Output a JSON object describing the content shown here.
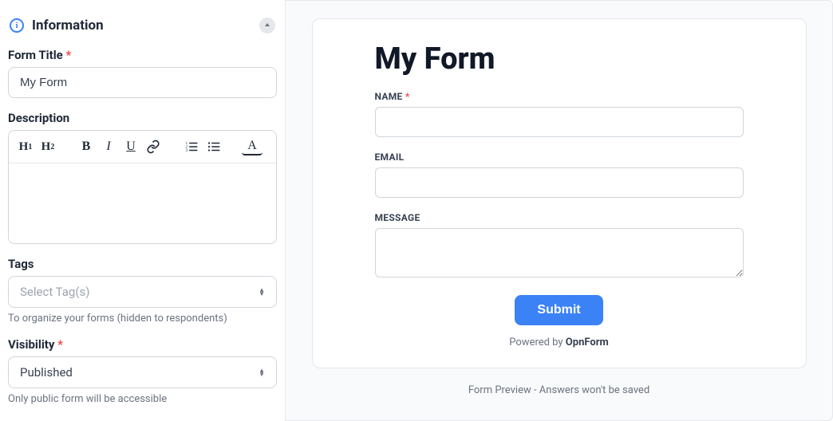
{
  "sidebar": {
    "section_title": "Information",
    "form_title_label": "Form Title",
    "form_title_value": "My Form",
    "description_label": "Description",
    "tags_label": "Tags",
    "tags_placeholder": "Select Tag(s)",
    "tags_hint": "To organize your forms (hidden to respondents)",
    "visibility_label": "Visibility",
    "visibility_value": "Published",
    "visibility_hint": "Only public form will be accessible",
    "required_mark": "*"
  },
  "rte_buttons": {
    "h1": "H",
    "h1_sub": "1",
    "h2": "H",
    "h2_sub": "2",
    "bold": "B",
    "italic": "I",
    "underline": "U",
    "color": "A"
  },
  "preview": {
    "title": "My Form",
    "fields": [
      {
        "label": "NAME",
        "required": true,
        "type": "text"
      },
      {
        "label": "EMAIL",
        "required": false,
        "type": "text"
      },
      {
        "label": "MESSAGE",
        "required": false,
        "type": "textarea"
      }
    ],
    "submit_label": "Submit",
    "powered_prefix": "Powered by ",
    "powered_brand": "OpnForm",
    "note": "Form Preview - Answers won't be saved"
  }
}
